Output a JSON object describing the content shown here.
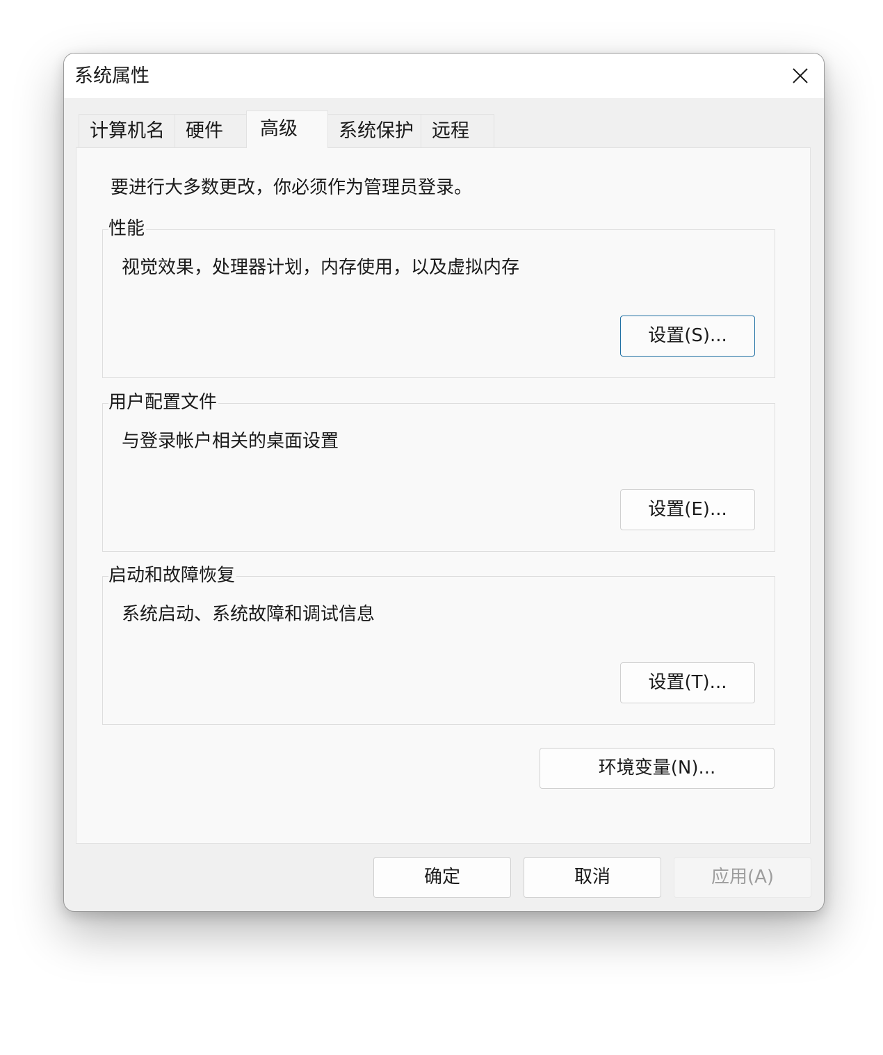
{
  "window": {
    "title": "系统属性"
  },
  "tabs": [
    {
      "label": "计算机名"
    },
    {
      "label": "硬件"
    },
    {
      "label": "高级",
      "active": true
    },
    {
      "label": "系统保护"
    },
    {
      "label": "远程"
    }
  ],
  "advanced": {
    "intro": "要进行大多数更改，你必须作为管理员登录。",
    "performance": {
      "title": "性能",
      "description": "视觉效果，处理器计划，内存使用，以及虚拟内存",
      "button": "设置(S)..."
    },
    "user_profiles": {
      "title": "用户配置文件",
      "description": "与登录帐户相关的桌面设置",
      "button": "设置(E)..."
    },
    "startup_recovery": {
      "title": "启动和故障恢复",
      "description": "系统启动、系统故障和调试信息",
      "button": "设置(T)..."
    },
    "env_button": "环境变量(N)..."
  },
  "footer": {
    "ok": "确定",
    "cancel": "取消",
    "apply": "应用(A)"
  },
  "icons": {
    "close": "close-icon"
  },
  "colors": {
    "focus_border": "#1f6fa3",
    "panel_bg": "#f9f9f9",
    "window_bg": "#f0f0f0",
    "disabled_text": "#9d9d9d"
  }
}
